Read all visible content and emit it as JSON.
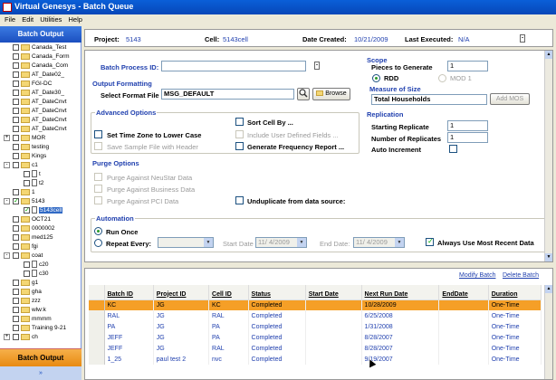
{
  "window": {
    "title": "Virtual Genesys - Batch Queue"
  },
  "menu": [
    "File",
    "Edit",
    "Utilities",
    "Help"
  ],
  "sidebar": {
    "title": "Batch Output",
    "items": [
      {
        "label": "Canada_Test",
        "type": "folder",
        "check": true
      },
      {
        "label": "Canada_Form",
        "type": "folder",
        "check": true
      },
      {
        "label": "Canada_Com",
        "type": "folder",
        "check": true
      },
      {
        "label": "AT_Date02_",
        "type": "folder",
        "check": true
      },
      {
        "label": "FGI-DC",
        "type": "folder",
        "check": true
      },
      {
        "label": "AT_Date30_",
        "type": "folder",
        "check": true
      },
      {
        "label": "AT_DateCnvt",
        "type": "folder",
        "check": true
      },
      {
        "label": "AT_DateCnvt",
        "type": "folder",
        "check": true
      },
      {
        "label": "AT_DateCnvt",
        "type": "folder",
        "check": true
      },
      {
        "label": "AT_DateCnvt",
        "type": "folder",
        "check": true
      },
      {
        "label": "MOR",
        "type": "folder",
        "check": true,
        "expander": "+"
      },
      {
        "label": "testing",
        "type": "folder",
        "check": true
      },
      {
        "label": "Kings",
        "type": "folder",
        "check": true
      },
      {
        "label": "c1",
        "type": "folder",
        "check": true,
        "expander": "-"
      },
      {
        "label": "t",
        "type": "file",
        "check": true,
        "indent": true
      },
      {
        "label": "t2",
        "type": "file",
        "check": true,
        "indent": true
      },
      {
        "label": "1",
        "type": "folder",
        "check": true
      },
      {
        "label": "5143",
        "type": "folder",
        "check": true,
        "checked": true,
        "expander": "-"
      },
      {
        "label": "5143cell",
        "type": "file",
        "check": true,
        "checked": true,
        "indent": true,
        "selected": true
      },
      {
        "label": "OCT21",
        "type": "folder",
        "check": true
      },
      {
        "label": "0000002",
        "type": "folder",
        "check": true
      },
      {
        "label": "med125",
        "type": "folder",
        "check": true
      },
      {
        "label": "fgi",
        "type": "folder",
        "check": true
      },
      {
        "label": "coat",
        "type": "folder",
        "check": true,
        "expander": "-"
      },
      {
        "label": "c20",
        "type": "file",
        "check": true,
        "indent": true
      },
      {
        "label": "c30",
        "type": "file",
        "check": true,
        "indent": true
      },
      {
        "label": "g1",
        "type": "folder",
        "check": true
      },
      {
        "label": "gha",
        "type": "folder",
        "check": true
      },
      {
        "label": "zzz",
        "type": "folder",
        "check": true
      },
      {
        "label": "wlw:k",
        "type": "folder",
        "check": true
      },
      {
        "label": "mmmm",
        "type": "folder",
        "check": true
      },
      {
        "label": "Training 9-21",
        "type": "folder",
        "check": true
      },
      {
        "label": "ch",
        "type": "folder",
        "check": true,
        "expander": "+"
      }
    ],
    "footer_button": "Batch Output",
    "footer_chevron": "»"
  },
  "info": {
    "project_label": "Project:",
    "project": "5143",
    "cell_label": "Cell:",
    "cell": "5143cell",
    "created_label": "Date Created:",
    "created": "10/21/2009",
    "executed_label": "Last Executed:",
    "executed": "N/A"
  },
  "form": {
    "batch_id_label": "Batch Process ID:",
    "batch_id_value": "",
    "output_formatting": {
      "title": "Output Formatting",
      "select_format_label": "Select Format File",
      "format_value": "MSG_DEFAULT",
      "browse_label": "Browse"
    },
    "scope": {
      "title": "Scope",
      "pieces_label": "Pieces to Generate",
      "pieces_value": "1",
      "rdd_label": "RDD",
      "mod_label": "MOD 1"
    },
    "measure": {
      "title": "Measure of Size",
      "value": "Total Households",
      "add_mos_label": "Add MOS"
    },
    "advanced": {
      "title": "Advanced Options",
      "time_zone_label": "Set Time Zone to Lower Case",
      "save_sample_label": "Save Sample File with Header",
      "sort_cell_label": "Sort Cell By ...",
      "include_udf_label": "Include User Defined Fields ...",
      "freq_report_label": "Generate Frequency Report ..."
    },
    "replication": {
      "title": "Replication",
      "starting_label": "Starting Replicate",
      "starting_value": "1",
      "number_label": "Number of Replicates",
      "number_value": "1",
      "auto_inc_label": "Auto Increment"
    },
    "purge": {
      "title": "Purge Options",
      "neustar_label": "Purge Against NeuStar Data",
      "business_label": "Purge Against Business Data",
      "pci_label": "Purge Against PCI Data",
      "unduplicate_label": "Unduplicate from data source:"
    },
    "automation": {
      "title": "Automation",
      "run_once_label": "Run Once",
      "repeat_label": "Repeat Every:",
      "start_date_label": "Start Date",
      "start_date_value": "11/ 4/2009",
      "end_date_label": "End Date:",
      "end_date_value": "11/ 4/2009",
      "recent_data_label": "Always Use Most Recent Data"
    }
  },
  "grid": {
    "modify_label": "Modify Batch",
    "delete_label": "Delete Batch",
    "columns": [
      "Batch ID",
      "Project ID",
      "Cell ID",
      "Status",
      "Start Date",
      "Next Run Date",
      "EndDate",
      "Duration"
    ],
    "rows": [
      [
        "KC",
        "JG",
        "KC",
        "Completed",
        "",
        "10/28/2009",
        "",
        "One-Time"
      ],
      [
        "RAL",
        "JG",
        "RAL",
        "Completed",
        "",
        "6/25/2008",
        "",
        "One-Time"
      ],
      [
        "PA",
        "JG",
        "PA",
        "Completed",
        "",
        "1/31/2008",
        "",
        "One-Time"
      ],
      [
        "JEFF",
        "JG",
        "PA",
        "Completed",
        "",
        "8/28/2007",
        "",
        "One-Time"
      ],
      [
        "JEFF",
        "JG",
        "RAL",
        "Completed",
        "",
        "8/28/2007",
        "",
        "One-Time"
      ],
      [
        "1_25",
        "paul test 2",
        "nvc",
        "Completed",
        "",
        "9/19/2007",
        "",
        "One-Time"
      ]
    ]
  }
}
